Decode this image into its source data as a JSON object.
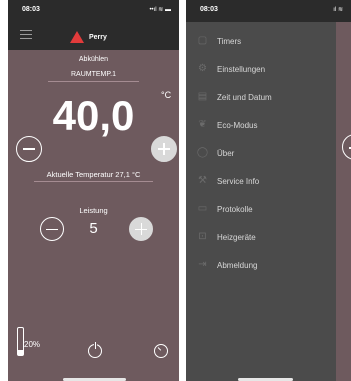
{
  "left": {
    "status": {
      "time": "08:03",
      "icons": "••ıl ≋ ▬"
    },
    "brand": {
      "name": "Perry"
    },
    "mode": "Abkühlen",
    "temp_name": "RAUMTEMP.1",
    "setpoint": "40,0",
    "unit": "°C",
    "actual_temperature": "Aktuelle Temperatur 27,1 °C",
    "leistung_label": "Leistung",
    "leistung_value": "5",
    "battery_level": 0.2,
    "battery_percent": "20%"
  },
  "right": {
    "status": {
      "time": "08:03",
      "icons": "ıl ≋"
    },
    "menu": [
      {
        "label": "Timers",
        "icon": "timer-icon"
      },
      {
        "label": "Einstellungen",
        "icon": "gear-icon"
      },
      {
        "label": "Zeit und Datum",
        "icon": "calendar-icon"
      },
      {
        "label": "Eco-Modus",
        "icon": "leaf-icon"
      },
      {
        "label": "Über",
        "icon": "info-icon"
      },
      {
        "label": "Service Info",
        "icon": "wrench-icon"
      },
      {
        "label": "Protokolle",
        "icon": "document-icon"
      },
      {
        "label": "Heizgeräte",
        "icon": "heater-icon"
      },
      {
        "label": "Abmeldung",
        "icon": "logout-icon"
      }
    ]
  },
  "colors": {
    "panel_bg": "#6e5a5e",
    "bar_bg": "#2b2b2b",
    "menu_bg": "#4b4b4b",
    "brand_red": "#e23b3b"
  }
}
